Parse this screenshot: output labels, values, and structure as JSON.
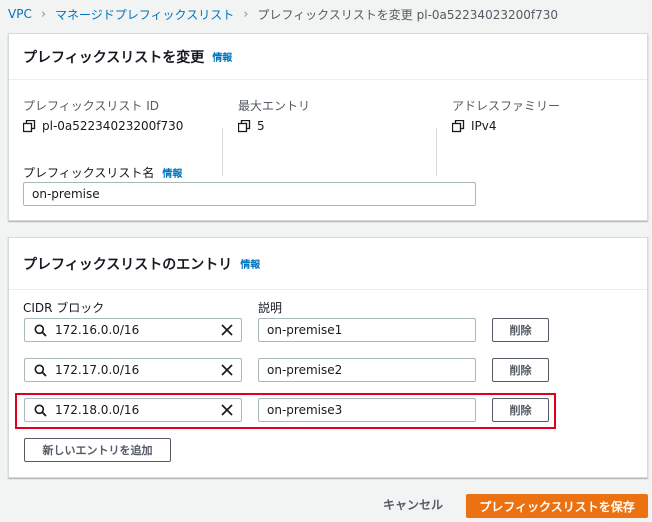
{
  "breadcrumb": {
    "items": [
      "VPC",
      "マネージドプレフィックスリスト",
      "プレフィックスリストを変更 pl-0a52234023200f730"
    ]
  },
  "info_label": "情報",
  "modify_panel": {
    "title": "プレフィックスリストを変更",
    "details": [
      {
        "label": "プレフィックスリスト ID",
        "value": "pl-0a52234023200f730"
      },
      {
        "label": "最大エントリ",
        "value": "5"
      },
      {
        "label": "アドレスファミリー",
        "value": "IPv4"
      }
    ],
    "name_label": "プレフィックスリスト名",
    "name_value": "on-premise"
  },
  "entries_panel": {
    "title": "プレフィックスリストのエントリ",
    "cidr_header": "CIDR ブロック",
    "desc_header": "説明",
    "rows": [
      {
        "cidr": "172.16.0.0/16",
        "description": "on-premise1",
        "remove_label": "削除"
      },
      {
        "cidr": "172.17.0.0/16",
        "description": "on-premise2",
        "remove_label": "削除"
      },
      {
        "cidr": "172.18.0.0/16",
        "description": "on-premise3",
        "remove_label": "削除"
      }
    ],
    "add_entry_label": "新しいエントリを追加"
  },
  "footer": {
    "cancel_label": "キャンセル",
    "save_label": "プレフィックスリストを保存"
  },
  "colors": {
    "link": "#0073bb",
    "primary": "#ec7211",
    "highlight": "#e0001b",
    "background": "#f2f3f3"
  }
}
